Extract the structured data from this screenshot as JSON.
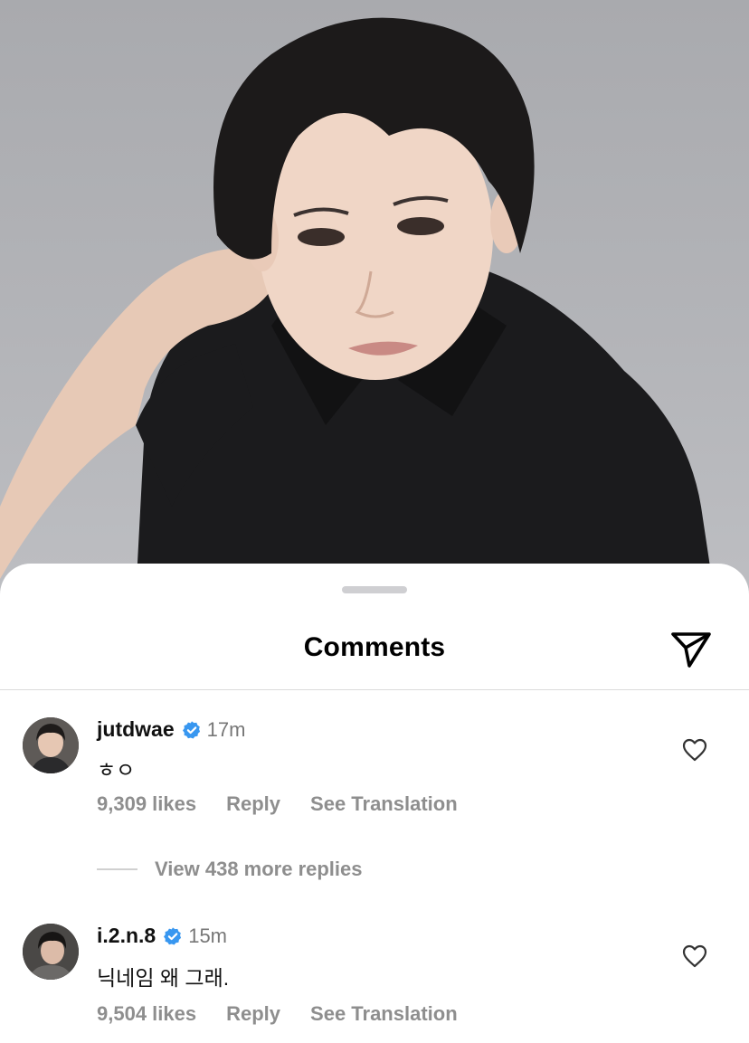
{
  "sheet": {
    "title": "Comments"
  },
  "comments": [
    {
      "username": "jutdwae",
      "verified": true,
      "time": "17m",
      "text": "ㅎㅇ",
      "likes": "9,309 likes",
      "reply_label": "Reply",
      "translate_label": "See Translation"
    },
    {
      "username": "i.2.n.8",
      "verified": true,
      "time": "15m",
      "text": "닉네임 왜 그래.",
      "likes": "9,504 likes",
      "reply_label": "Reply",
      "translate_label": "See Translation"
    }
  ],
  "replies": {
    "view_more_label": "View 438 more replies"
  },
  "icons": {
    "share": "paper-plane-icon",
    "like": "heart-outline-icon",
    "verified": "verified-badge-icon"
  },
  "colors": {
    "verified_blue": "#3897f0",
    "meta_gray": "#8e8e8e",
    "divider": "#dbdbdb"
  }
}
